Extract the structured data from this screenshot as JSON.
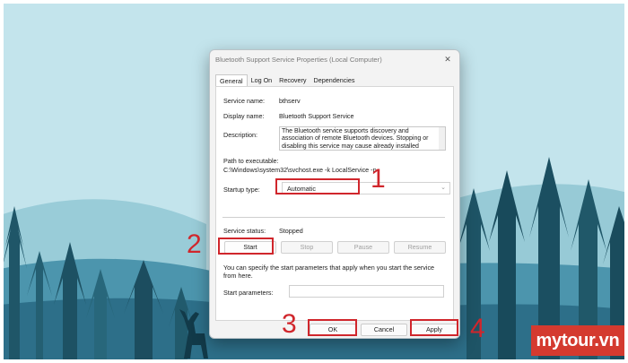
{
  "dialog": {
    "title": "Bluetooth Support Service Properties (Local Computer)",
    "close_glyph": "✕",
    "tabs": [
      "General",
      "Log On",
      "Recovery",
      "Dependencies"
    ],
    "active_tab": "General",
    "service_name_label": "Service name:",
    "service_name_value": "bthserv",
    "display_name_label": "Display name:",
    "display_name_value": "Bluetooth Support Service",
    "description_label": "Description:",
    "description_value": "The Bluetooth service supports discovery and association of remote Bluetooth devices.  Stopping or disabling this service may cause already installed",
    "path_label": "Path to executable:",
    "path_value": "C:\\Windows\\system32\\svchost.exe -k LocalService -p",
    "startup_type_label": "Startup type:",
    "startup_type_value": "Automatic",
    "service_status_label": "Service status:",
    "service_status_value": "Stopped",
    "buttons": {
      "start": "Start",
      "stop": "Stop",
      "pause": "Pause",
      "resume": "Resume"
    },
    "hint": "You can specify the start parameters that apply when you start the service from here.",
    "start_params_label": "Start parameters:",
    "start_params_value": "",
    "footer": {
      "ok": "OK",
      "cancel": "Cancel",
      "apply": "Apply"
    }
  },
  "annotations": [
    "1",
    "2",
    "3",
    "4"
  ],
  "watermark": "mytour.vn",
  "colors": {
    "highlight": "#d0262c",
    "logo_bg": "#d43a2f"
  }
}
